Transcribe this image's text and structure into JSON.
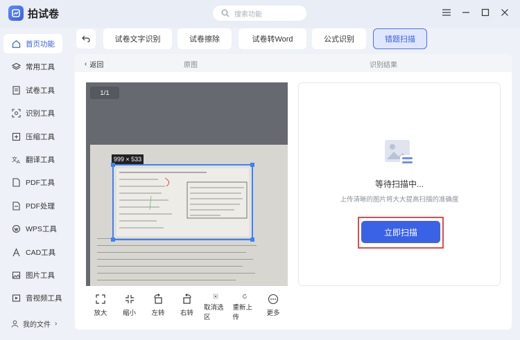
{
  "app": {
    "name": "拍试卷"
  },
  "search": {
    "placeholder": "搜索功能"
  },
  "sidebar": {
    "items": [
      {
        "label": "首页功能",
        "icon": "home-icon",
        "active": true
      },
      {
        "label": "常用工具",
        "icon": "layers-icon",
        "active": false
      },
      {
        "label": "试卷工具",
        "icon": "document-icon",
        "active": false
      },
      {
        "label": "识别工具",
        "icon": "scan-icon",
        "active": false
      },
      {
        "label": "压缩工具",
        "icon": "compress-icon",
        "active": false
      },
      {
        "label": "翻译工具",
        "icon": "translate-icon",
        "active": false
      },
      {
        "label": "PDF工具",
        "icon": "pdf-icon",
        "active": false
      },
      {
        "label": "PDF处理",
        "icon": "pdf-process-icon",
        "active": false
      },
      {
        "label": "WPS工具",
        "icon": "wps-icon",
        "active": false
      },
      {
        "label": "CAD工具",
        "icon": "cad-icon",
        "active": false
      },
      {
        "label": "图片工具",
        "icon": "image-icon",
        "active": false
      },
      {
        "label": "音视频工具",
        "icon": "av-icon",
        "active": false
      }
    ],
    "my_files": "我的文件"
  },
  "tabs": [
    {
      "label": "试卷文字识别",
      "active": false
    },
    {
      "label": "试卷擦除",
      "active": false
    },
    {
      "label": "试卷转Word",
      "active": false
    },
    {
      "label": "公式识别",
      "active": false
    },
    {
      "label": "错题扫描",
      "active": true
    }
  ],
  "subheader": {
    "back": "返回",
    "original": "原图",
    "result": "识别结果"
  },
  "preview": {
    "pager": "1/1",
    "dimensions": "999 × 533"
  },
  "toolbar": [
    {
      "label": "放大",
      "icon": "zoom-in-icon"
    },
    {
      "label": "缩小",
      "icon": "zoom-out-icon"
    },
    {
      "label": "左转",
      "icon": "rotate-left-icon"
    },
    {
      "label": "右转",
      "icon": "rotate-right-icon"
    },
    {
      "label": "取消选区",
      "icon": "cancel-selection-icon"
    },
    {
      "label": "重新上传",
      "icon": "reupload-icon"
    },
    {
      "label": "更多",
      "icon": "more-icon"
    }
  ],
  "result": {
    "status": "等待扫描中...",
    "hint": "上传清晰的图片将大大提高扫描的准确度",
    "scan_button": "立即扫描"
  },
  "colors": {
    "accent": "#3a62e6",
    "highlight_border": "#e14b4b"
  }
}
